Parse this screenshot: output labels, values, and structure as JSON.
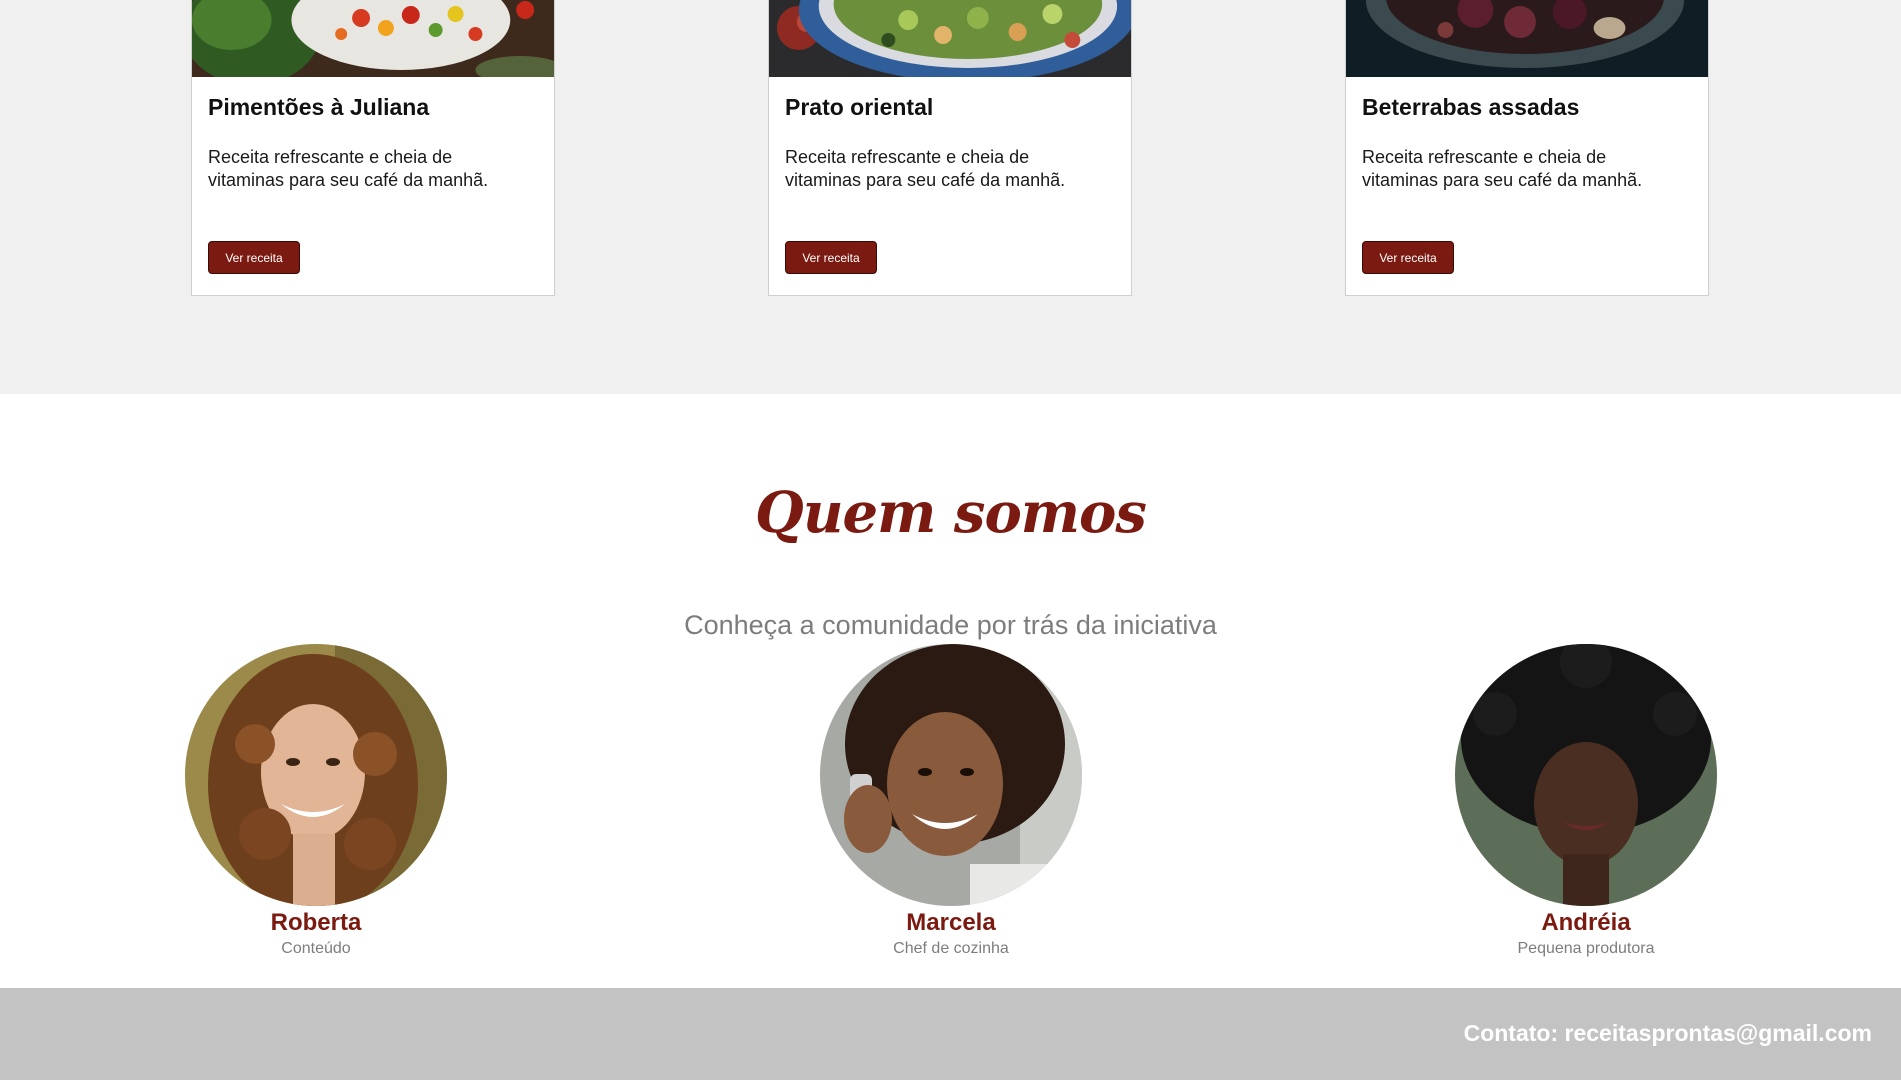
{
  "recipes": {
    "cards": [
      {
        "title": "Pimentões à Juliana",
        "description": "Receita refrescante e cheia de vitaminas para seu café da manhã.",
        "button_label": "Ver receita",
        "image": "salad-peppers-photo"
      },
      {
        "title": "Prato oriental",
        "description": "Receita refrescante e cheia de vitaminas para seu café da manhã.",
        "button_label": "Ver receita",
        "image": "oriental-bowl-photo"
      },
      {
        "title": "Beterrabas assadas",
        "description": "Receita refrescante e cheia de vitaminas para seu café da manhã.",
        "button_label": "Ver receita",
        "image": "roasted-beets-photo"
      }
    ]
  },
  "about": {
    "title": "Quem somos",
    "subtitle": "Conheça a comunidade por trás da iniciativa",
    "members": [
      {
        "name": "Roberta",
        "role": "Conteúdo",
        "image": "roberta-portrait"
      },
      {
        "name": "Marcela",
        "role": "Chef de cozinha",
        "image": "marcela-portrait"
      },
      {
        "name": "Andréia",
        "role": "Pequena produtora",
        "image": "andreia-portrait"
      }
    ]
  },
  "footer": {
    "contact": "Contato: receitasprontas@gmail.com"
  },
  "colors": {
    "accent": "#7a1a10",
    "section_bg": "#f0f0f0",
    "footer_bg": "#c3c3c3",
    "muted_text": "#7d7d7d"
  }
}
